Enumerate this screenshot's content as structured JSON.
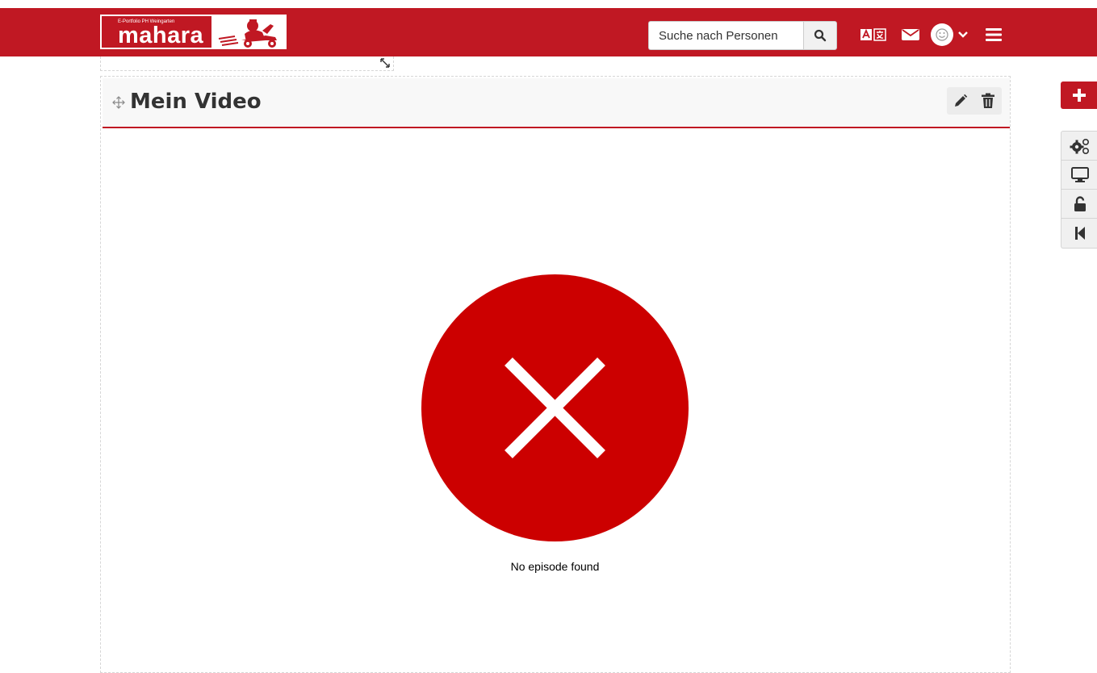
{
  "header": {
    "logo": {
      "subtitle": "E-Portfolio PH Weingarten",
      "name": "mahara"
    },
    "search": {
      "placeholder": "Suche nach Personen",
      "button_icon": "search-icon"
    },
    "icons": [
      "language-icon",
      "envelope-icon",
      "avatar-icon",
      "chevron-down-icon",
      "hamburger-menu-icon"
    ]
  },
  "block": {
    "title": "Mein Video",
    "actions": [
      "pencil-icon",
      "trash-icon"
    ],
    "content": {
      "error_icon": "error-x-circle-icon",
      "message": "No episode found"
    }
  },
  "side_toolbar": {
    "add_icon": "plus-icon",
    "items": [
      "settings-gears-icon",
      "display-icon",
      "unlock-icon",
      "step-back-icon"
    ]
  },
  "colors": {
    "brand_red": "#c01823",
    "error_red": "#cc0000",
    "header_bg": "#f8f8f8"
  }
}
